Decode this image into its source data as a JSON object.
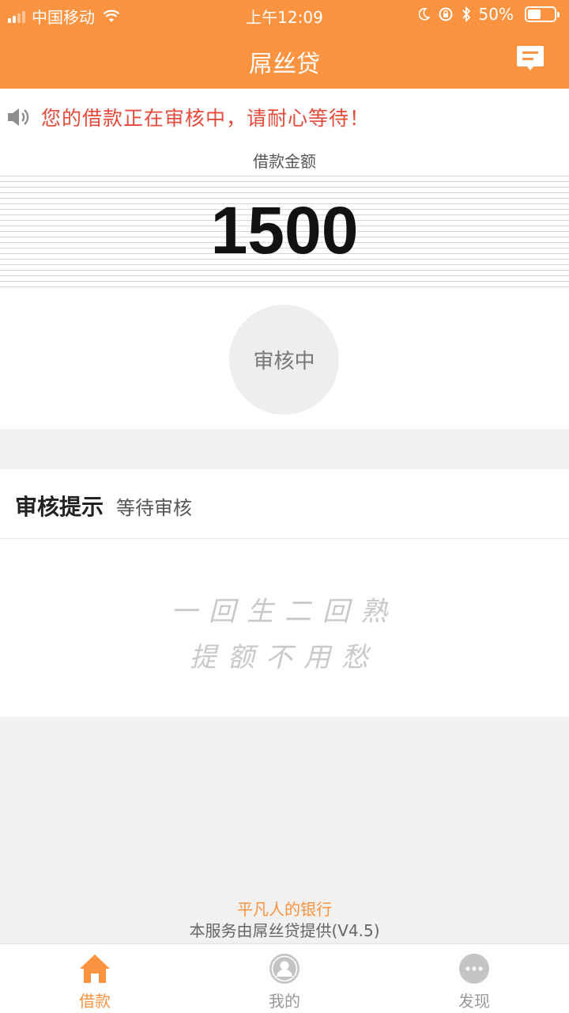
{
  "status_bar": {
    "carrier": "中国移动",
    "time": "上午12:09",
    "battery": "50%",
    "battery_level": 0.5
  },
  "nav": {
    "title": "屌丝贷",
    "icon": "message-icon"
  },
  "notice": {
    "icon": "speaker-icon",
    "text": "您的借款正在审核中，请耐心等待！",
    "color": "#e64b3b"
  },
  "loan": {
    "amount_label": "借款金额",
    "amount": "1500",
    "status": "审核中"
  },
  "review": {
    "title": "审核提示",
    "subtitle": "等待审核",
    "slogan_line1": "一回生二回熟",
    "slogan_line2": "提额不用愁"
  },
  "footer": {
    "tagline": "平凡人的银行",
    "credit": "本服务由屌丝贷提供(V4.5)"
  },
  "tabs": [
    {
      "label": "借款",
      "icon": "home-icon",
      "active": true
    },
    {
      "label": "我的",
      "icon": "profile-icon",
      "active": false
    },
    {
      "label": "发现",
      "icon": "more-icon",
      "active": false
    }
  ],
  "colors": {
    "brand": "#fc9341",
    "alert": "#e64b3b"
  }
}
